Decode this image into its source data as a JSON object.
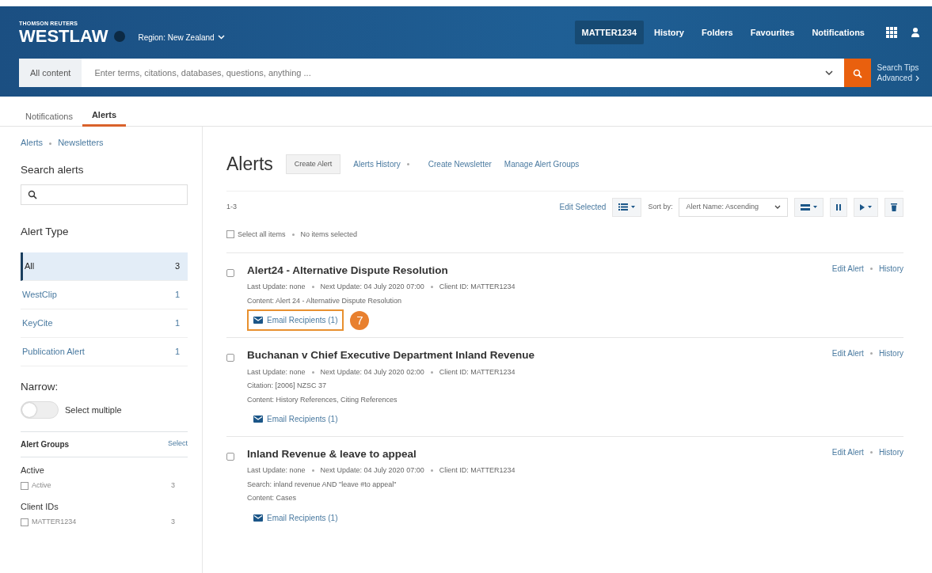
{
  "header": {
    "brand_top": "THOMSON REUTERS",
    "brand": "WESTLAW",
    "region": "Region: New Zealand",
    "nav_items": [
      {
        "label": "MATTER1234",
        "selected": true
      },
      {
        "label": "History",
        "selected": false
      },
      {
        "label": "Folders",
        "selected": false
      },
      {
        "label": "Favourites",
        "selected": false
      },
      {
        "label": "Notifications",
        "selected": false
      }
    ],
    "search": {
      "scope": "All content",
      "placeholder": "Enter terms, citations, databases, questions, anything ...",
      "tips": "Search Tips",
      "advanced": "Advanced"
    }
  },
  "tabs": [
    {
      "label": "Notifications",
      "selected": false
    },
    {
      "label": "Alerts",
      "selected": true
    }
  ],
  "sidebar": {
    "links": [
      "Alerts",
      "Newsletters"
    ],
    "search_title": "Search alerts",
    "alert_type_title": "Alert Type",
    "types": [
      {
        "label": "All",
        "count": "3",
        "selected": true
      },
      {
        "label": "WestClip",
        "count": "1",
        "selected": false
      },
      {
        "label": "KeyCite",
        "count": "1",
        "selected": false
      },
      {
        "label": "Publication Alert",
        "count": "1",
        "selected": false
      }
    ],
    "narrow_title": "Narrow:",
    "toggle": {
      "label": "Select multiple",
      "on": false
    },
    "groups_title": "Alert Groups",
    "groups_action": "Select",
    "facets": [
      {
        "title": "Active",
        "options": [
          {
            "label": "Active",
            "count": "3",
            "checked": false
          }
        ]
      },
      {
        "title": "Client IDs",
        "options": [
          {
            "label": "MATTER1234",
            "count": "3",
            "checked": false
          }
        ]
      }
    ]
  },
  "main": {
    "title": "Alerts",
    "create_button": "Create Alert",
    "links": [
      "Alerts History",
      "Create Newsletter",
      "Manage Alert Groups"
    ],
    "range": "1-3",
    "edit_selected": "Edit Selected",
    "sort_label": "Sort by:",
    "sort_value": "Alert Name: Ascending",
    "select_all": {
      "label": "Select all items",
      "checked": false
    },
    "selection_status": "No items selected",
    "alerts": [
      {
        "title": "Alert24 - Alternative Dispute Resolution",
        "checked": false,
        "meta": [
          "Last Update: none",
          "Next Update: 04 July 2020 07:00",
          "Client ID: MATTER1234"
        ],
        "lines": [
          "Content: Alert 24 - Alternative Dispute Resolution"
        ],
        "recipients": "Email Recipients (1)",
        "highlighted": true,
        "callout": "7",
        "actions": [
          "Edit Alert",
          "History"
        ]
      },
      {
        "title": "Buchanan v Chief Executive Department Inland Revenue",
        "checked": false,
        "meta": [
          "Last Update: none",
          "Next Update: 04 July 2020 02:00",
          "Client ID: MATTER1234"
        ],
        "lines": [
          "Citation: [2006] NZSC 37",
          "Content: History References, Citing References"
        ],
        "recipients": "Email Recipients (1)",
        "highlighted": false,
        "actions": [
          "Edit Alert",
          "History"
        ]
      },
      {
        "title": "Inland Revenue & leave to appeal",
        "checked": false,
        "meta": [
          "Last Update: none",
          "Next Update: 04 July 2020 07:00",
          "Client ID: MATTER1234"
        ],
        "lines": [
          "Search: inland revenue AND \"leave #to appeal\"",
          "Content: Cases"
        ],
        "recipients": "Email Recipients (1)",
        "highlighted": false,
        "actions": [
          "Edit Alert",
          "History"
        ]
      }
    ]
  }
}
